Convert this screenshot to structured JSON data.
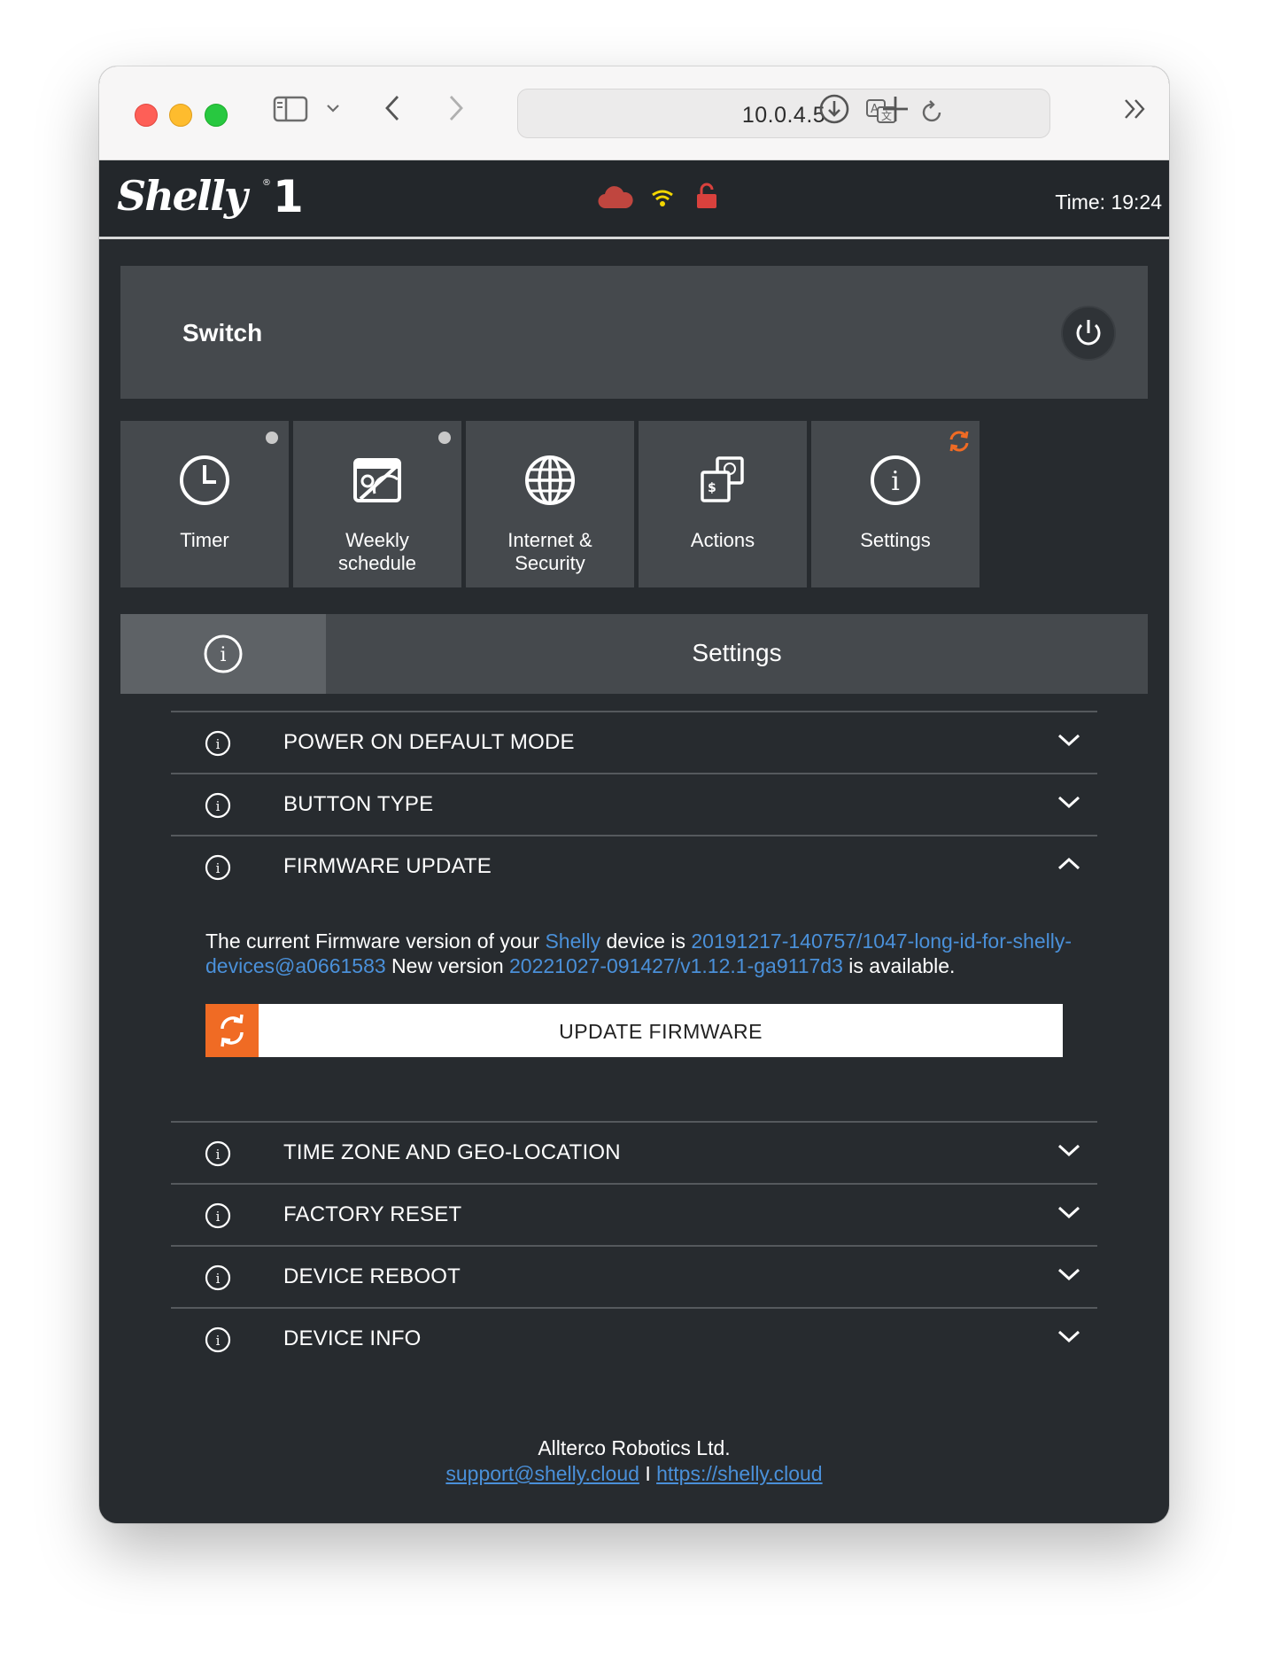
{
  "browser": {
    "address": "10.0.4.5"
  },
  "header": {
    "logo_text": "Shelly 1",
    "time_label": "Time: 19:24",
    "status_icons": [
      "cloud-icon",
      "wifi-icon",
      "unlocked-icon"
    ],
    "colors": {
      "cloud": "#c0463f",
      "wifi": "#f2d600",
      "lock": "#d9413d"
    }
  },
  "switch": {
    "label": "Switch"
  },
  "tiles": [
    {
      "label_line1": "Timer",
      "label_line2": "",
      "icon": "clock-icon",
      "dot": true
    },
    {
      "label_line1": "Weekly",
      "label_line2": "schedule",
      "icon": "calendar-disabled-icon",
      "dot": true
    },
    {
      "label_line1": "Internet &",
      "label_line2": "Security",
      "icon": "globe-icon",
      "dot": false
    },
    {
      "label_line1": "Actions",
      "label_line2": "",
      "icon": "actions-icon",
      "dot": false
    },
    {
      "label_line1": "Settings",
      "label_line2": "",
      "icon": "info-icon",
      "dot": false,
      "badge": "refresh-icon"
    }
  ],
  "settings": {
    "title": "Settings",
    "sections": [
      {
        "label": "POWER ON DEFAULT MODE",
        "expanded": false
      },
      {
        "label": "BUTTON TYPE",
        "expanded": false
      },
      {
        "label": "FIRMWARE UPDATE",
        "expanded": true
      },
      {
        "label": "TIME ZONE AND GEO-LOCATION",
        "expanded": false
      },
      {
        "label": "FACTORY RESET",
        "expanded": false
      },
      {
        "label": "DEVICE REBOOT",
        "expanded": false
      },
      {
        "label": "DEVICE INFO",
        "expanded": false
      }
    ],
    "firmware": {
      "text_1": "The current Firmware version of your ",
      "brand": "Shelly",
      "text_2": " device is ",
      "current_version": "20191217-140757/1047-long-id-for-shelly-devices@a0661583",
      "text_3": " New version ",
      "new_version": "20221027-091427/v1.12.1-ga9117d3",
      "text_4": " is available.",
      "button_label": "UPDATE FIRMWARE"
    }
  },
  "footer": {
    "company": "Allterco Robotics Ltd.",
    "email": "support@shelly.cloud",
    "separator": "I",
    "website": "https://shelly.cloud"
  },
  "colors": {
    "accent_orange": "#f06b24",
    "link_blue": "#4a90d9",
    "background": "#272b2f",
    "panel": "#45494d"
  }
}
